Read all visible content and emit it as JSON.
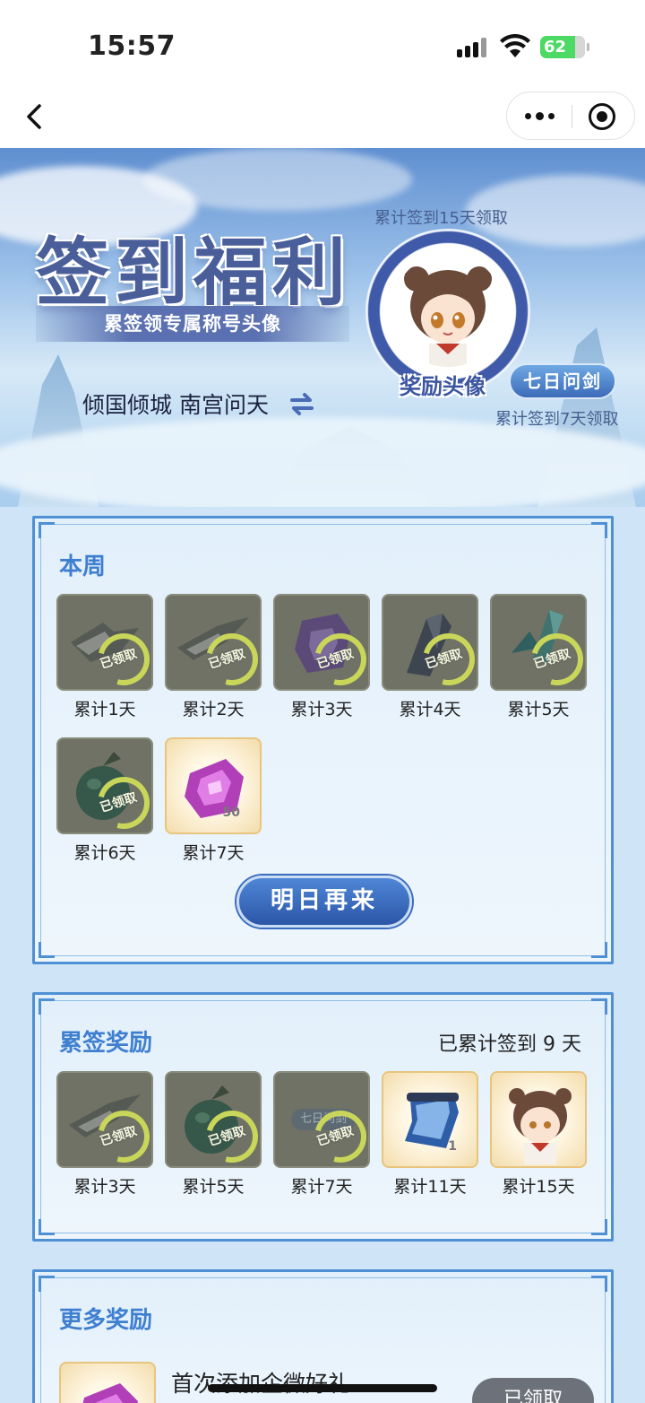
{
  "status": {
    "time": "15:57",
    "battery": "62"
  },
  "banner": {
    "title": "签到福利",
    "subtitle": "累签领专属称号头像",
    "user_names": "倾国倾城 南宫问天",
    "avatar_caption": "累计签到15天领取",
    "avatar_label": "奖励头像",
    "badge": "七日问剑",
    "badge_caption": "累计签到7天领取"
  },
  "week": {
    "title": "本周",
    "rewards": [
      {
        "caption": "累计1天",
        "claimed": true,
        "item": "weapon-gray"
      },
      {
        "caption": "累计2天",
        "claimed": true,
        "item": "weapon-gray"
      },
      {
        "caption": "累计3天",
        "claimed": true,
        "item": "purple-gem"
      },
      {
        "caption": "累计4天",
        "claimed": true,
        "item": "dark-crystal"
      },
      {
        "caption": "累计5天",
        "claimed": true,
        "item": "teal-crystal"
      },
      {
        "caption": "累计6天",
        "claimed": true,
        "item": "green-fruit"
      },
      {
        "caption": "累计7天",
        "claimed": false,
        "item": "purple-gem",
        "qty": "50"
      }
    ],
    "claimed_text": "已领取",
    "button": "明日再来"
  },
  "cumulative": {
    "title": "累签奖励",
    "summary": "已累计签到 9 天",
    "rewards": [
      {
        "caption": "累计3天",
        "claimed": true,
        "item": "weapon-gray"
      },
      {
        "caption": "累计5天",
        "claimed": true,
        "item": "green-fruit"
      },
      {
        "caption": "累计7天",
        "claimed": true,
        "item": "title-badge",
        "badge_text": "七日问剑"
      },
      {
        "caption": "累计11天",
        "claimed": false,
        "item": "blue-scroll",
        "qty": "1"
      },
      {
        "caption": "累计15天",
        "claimed": false,
        "item": "avatar"
      }
    ]
  },
  "more": {
    "title": "更多奖励",
    "row_title": "首次添加企微好礼",
    "button": "已领取"
  },
  "colors": {
    "accent": "#3f7fd0",
    "panel_border": "#4f8fd4",
    "button": "#2c56a8"
  }
}
